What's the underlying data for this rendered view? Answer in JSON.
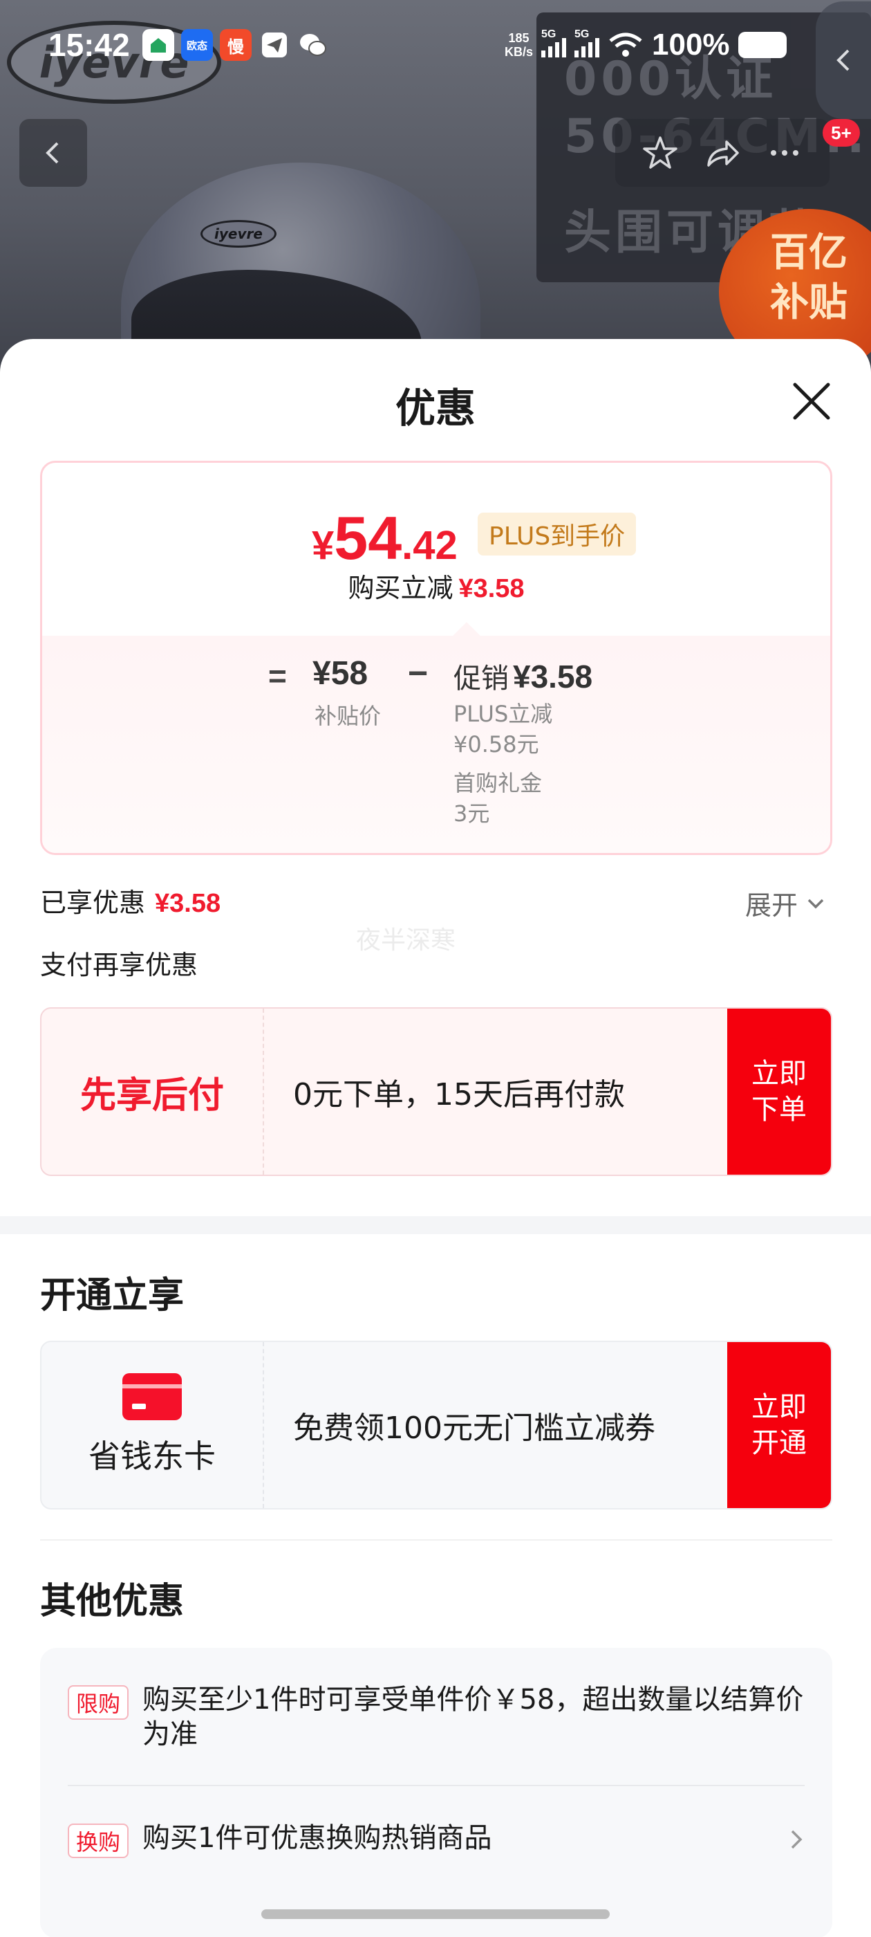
{
  "status_bar": {
    "time": "15:42",
    "apps": [
      "app-icon",
      "欧态",
      "慢",
      "send-icon",
      "wechat-icon"
    ],
    "net_speed": "185",
    "net_unit": "KB/s",
    "sig1": "5G",
    "sig2": "5G",
    "battery": "100%"
  },
  "product_bg": {
    "brand": "iyevre",
    "info_line1": "000认证",
    "info_line2": "50-64CM...",
    "info_line3": "头围可调节",
    "subsidy": "百亿补贴"
  },
  "header": {
    "badge": "5+"
  },
  "sheet": {
    "title": "优惠"
  },
  "price_card": {
    "yen": "¥",
    "price_int": "54",
    "price_dec": ".42",
    "plus_tag": "PLUS到手价",
    "reduce_label": "购买立减",
    "reduce_value": "¥3.58",
    "eq": "=",
    "base_price": "¥58",
    "base_label": "补贴价",
    "minus": "−",
    "promo_label": "促销",
    "promo_value": "¥3.58",
    "detail1_label": "PLUS立减",
    "detail1_value": "¥0.58元",
    "detail2_label": "首购礼金",
    "detail2_value": "3元"
  },
  "enjoyed": {
    "label": "已享优惠",
    "value": "¥3.58",
    "expand": "展开",
    "watermark": "夜半深寒",
    "pay_more": "支付再享优惠"
  },
  "bnpl": {
    "label": "先享后付",
    "text": "0元下单，15天后再付款",
    "cta_line1": "立即",
    "cta_line2": "下单"
  },
  "open_section": {
    "title": "开通立享",
    "card_label": "省钱东卡",
    "text": "免费领100元无门槛立减券",
    "cta_line1": "立即",
    "cta_line2": "开通"
  },
  "other_section": {
    "title": "其他优惠",
    "items": [
      {
        "tag": "限购",
        "text": "购买至少1件时可享受单件价￥58，超出数量以结算价为准"
      },
      {
        "tag": "换购",
        "text": "购买1件可优惠换购热销商品"
      }
    ]
  },
  "colors": {
    "accent_red": "#f01b2e",
    "cta_red": "#f5000d",
    "plus_gold": "#c37a1b"
  }
}
